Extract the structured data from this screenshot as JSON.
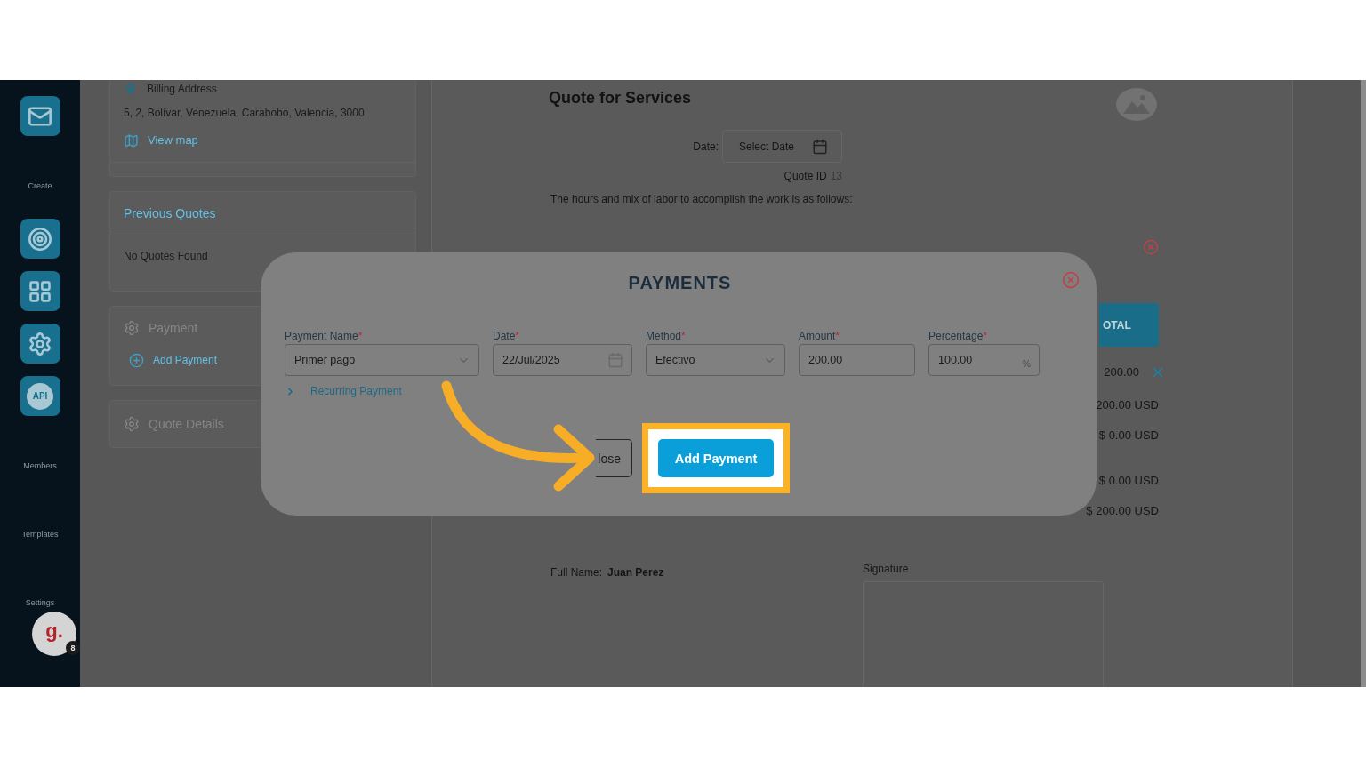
{
  "sidebar": {
    "items": [
      {
        "kind": "tile"
      },
      {
        "kind": "heading",
        "label": "Create"
      },
      {
        "kind": "tile"
      },
      {
        "kind": "tile"
      },
      {
        "kind": "tile"
      },
      {
        "kind": "tile",
        "label": "API"
      },
      {
        "kind": "heading",
        "label": "Members"
      },
      {
        "kind": "heading",
        "label": "Templates"
      },
      {
        "kind": "heading",
        "label": "Settings"
      }
    ],
    "avatar": {
      "initial": "g.",
      "badge": "8"
    }
  },
  "client_panel": {
    "billing": {
      "label": "Billing Address",
      "address": "5, 2, Bolívar, Venezuela, Carabobo, Valencia, 3000",
      "map_link": "View map"
    },
    "previous_quotes": {
      "title": "Previous Quotes",
      "empty_text": "No Quotes Found"
    },
    "payment": {
      "title": "Payment",
      "action": "Add Payment"
    },
    "quote_details": {
      "title": "Quote Details"
    }
  },
  "quote": {
    "title": "Quote for Services",
    "date": {
      "label": "Date:",
      "placeholder": "Select Date"
    },
    "quote_id": {
      "label": "Quote ID",
      "value": "13"
    },
    "intro": "The hours and mix of labor to accomplish the work is as follows:",
    "totals_header": "OTAL",
    "totals": [
      {
        "amount": "200.00",
        "removable": true
      },
      {
        "amount": "200.00 USD",
        "removable": false
      },
      {
        "amount": "$ 0.00 USD",
        "removable": false
      },
      {
        "amount": "$ 0.00 USD",
        "removable": false
      },
      {
        "amount": "$ 200.00 USD",
        "removable": false
      }
    ],
    "full_name": {
      "label": "Full Name:",
      "value": "Juan Perez"
    },
    "signature_label": "Signature"
  },
  "payments_dialog": {
    "title": "PAYMENTS",
    "fields": [
      {
        "kind": "select",
        "label": "Payment Name",
        "required_mark": "*",
        "value": "Primer pago"
      },
      {
        "kind": "date",
        "label": "Date",
        "required_mark": "*",
        "value": "22/Jul/2025"
      },
      {
        "kind": "select",
        "label": "Method",
        "required_mark": "*",
        "value": "Efectivo"
      },
      {
        "kind": "text",
        "label": "Amount",
        "required_mark": "*",
        "value": "200.00"
      },
      {
        "kind": "percent",
        "label": "Percentage",
        "required_mark": "*",
        "value": "100.00",
        "suffix": "%"
      }
    ],
    "recurring": {
      "label": "Recurring Payment",
      "expanded": false
    },
    "actions": [
      {
        "kind": "secondary",
        "label": "lose"
      },
      {
        "kind": "primary",
        "label": "Add Payment",
        "highlighted": true
      }
    ]
  }
}
